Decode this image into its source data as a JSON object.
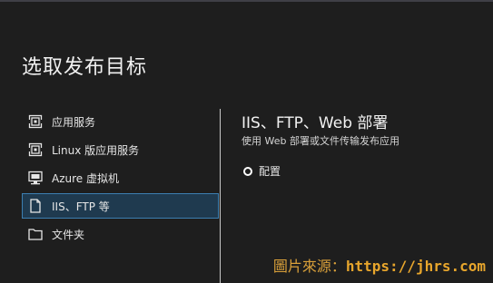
{
  "dialog": {
    "title": "选取发布目标"
  },
  "targets": [
    {
      "label": "应用服务",
      "icon": "app-service-icon",
      "selected": false
    },
    {
      "label": "Linux 版应用服务",
      "icon": "app-service-linux-icon",
      "selected": false
    },
    {
      "label": "Azure 虚拟机",
      "icon": "virtual-machine-icon",
      "selected": false
    },
    {
      "label": "IIS、FTP 等",
      "icon": "document-icon",
      "selected": true
    },
    {
      "label": "文件夹",
      "icon": "folder-icon",
      "selected": false
    }
  ],
  "details": {
    "title": "IIS、FTP、Web 部署",
    "description": "使用 Web 部署或文件传输发布应用",
    "option_label": "配置"
  },
  "watermark": {
    "prefix": "圖片來源：",
    "url": "https://jhrs.com"
  },
  "colors": {
    "background": "#1e1e1e",
    "selected_background": "#1f3a4f",
    "selected_border": "#3c7fb1",
    "watermark": "#e8a62c"
  }
}
